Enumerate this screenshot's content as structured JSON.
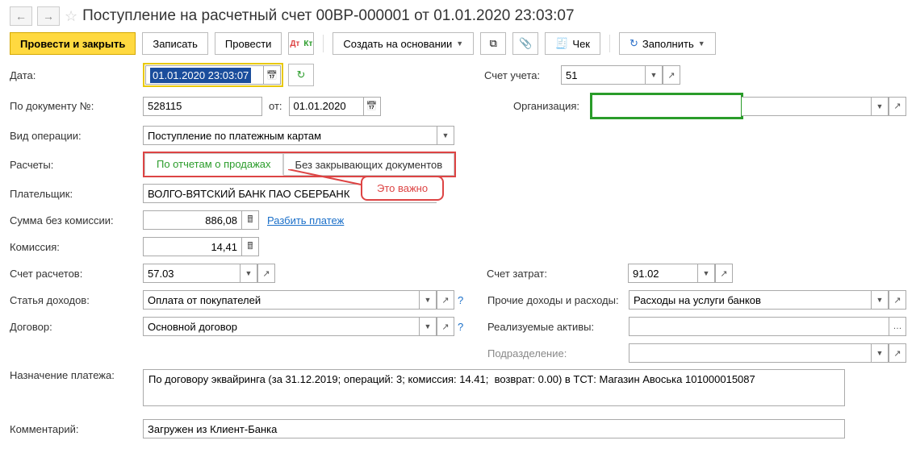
{
  "header": {
    "title": "Поступление на расчетный счет 00ВР-000001 от 01.01.2020 23:03:07"
  },
  "toolbar": {
    "post_close": "Провести и закрыть",
    "write": "Записать",
    "post": "Провести",
    "create_based": "Создать на основании",
    "check": "Чек",
    "fill": "Заполнить"
  },
  "labels": {
    "date": "Дата:",
    "doc_num": "По документу №:",
    "from": "от:",
    "op_type": "Вид операции:",
    "calc": "Расчеты:",
    "payer": "Плательщик:",
    "sum_no_fee": "Сумма без комиссии:",
    "commission": "Комиссия:",
    "account_calc": "Счет расчетов:",
    "income_item": "Статья доходов:",
    "contract": "Договор:",
    "purpose": "Назначение платежа:",
    "comment": "Комментарий:",
    "account": "Счет учета:",
    "org": "Организация:",
    "expense_account": "Счет затрат:",
    "other_income": "Прочие доходы и расходы:",
    "assets": "Реализуемые активы:",
    "division": "Подразделение:"
  },
  "values": {
    "date": "01.01.2020 23:03:07",
    "doc_num": "528115",
    "doc_date": "01.01.2020",
    "op_type": "Поступление по платежным картам",
    "tab1": "По отчетам о продажах",
    "tab2": "Без закрывающих документов",
    "payer": "ВОЛГО-ВЯТСКИЙ БАНК ПАО СБЕРБАНК",
    "sum_no_fee": "886,08",
    "split_link": "Разбить платеж",
    "commission": "14,41",
    "account_calc": "57.03",
    "income_item": "Оплата от покупателей",
    "contract": "Основной договор",
    "purpose": "По договору эквайринга (за 31.12.2019; операций: 3; комиссия: 14.41;  возврат: 0.00) в ТСТ: Магазин Авоська 101000015087",
    "comment": "Загружен из Клиент-Банка",
    "account": "51",
    "org": "",
    "expense_account": "91.02",
    "other_income": "Расходы на услуги банков",
    "assets": "",
    "division": ""
  },
  "callout": {
    "text": "Это важно"
  }
}
